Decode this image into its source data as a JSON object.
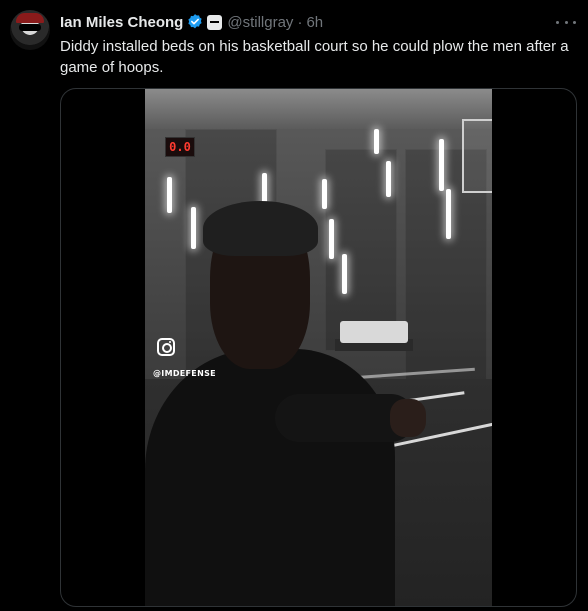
{
  "author": {
    "display_name": "Ian Miles Cheong",
    "handle": "@stillgray",
    "separator": "·",
    "time": "6h",
    "verified_icon": "verified-badge-icon",
    "affiliation_icon": "affiliation-badge-icon"
  },
  "tweet": {
    "text": "Diddy installed beds on his basketball court so he could plow the men after a game of hoops."
  },
  "media": {
    "scoreboard": "0.0",
    "watermark_icon": "instagram-icon",
    "watermark_handle": "@IMDEFENSE"
  },
  "colors": {
    "background": "#000000",
    "text_primary": "#e7e9ea",
    "text_secondary": "#71767b",
    "verified": "#1d9bf0",
    "border": "#2f3336"
  }
}
